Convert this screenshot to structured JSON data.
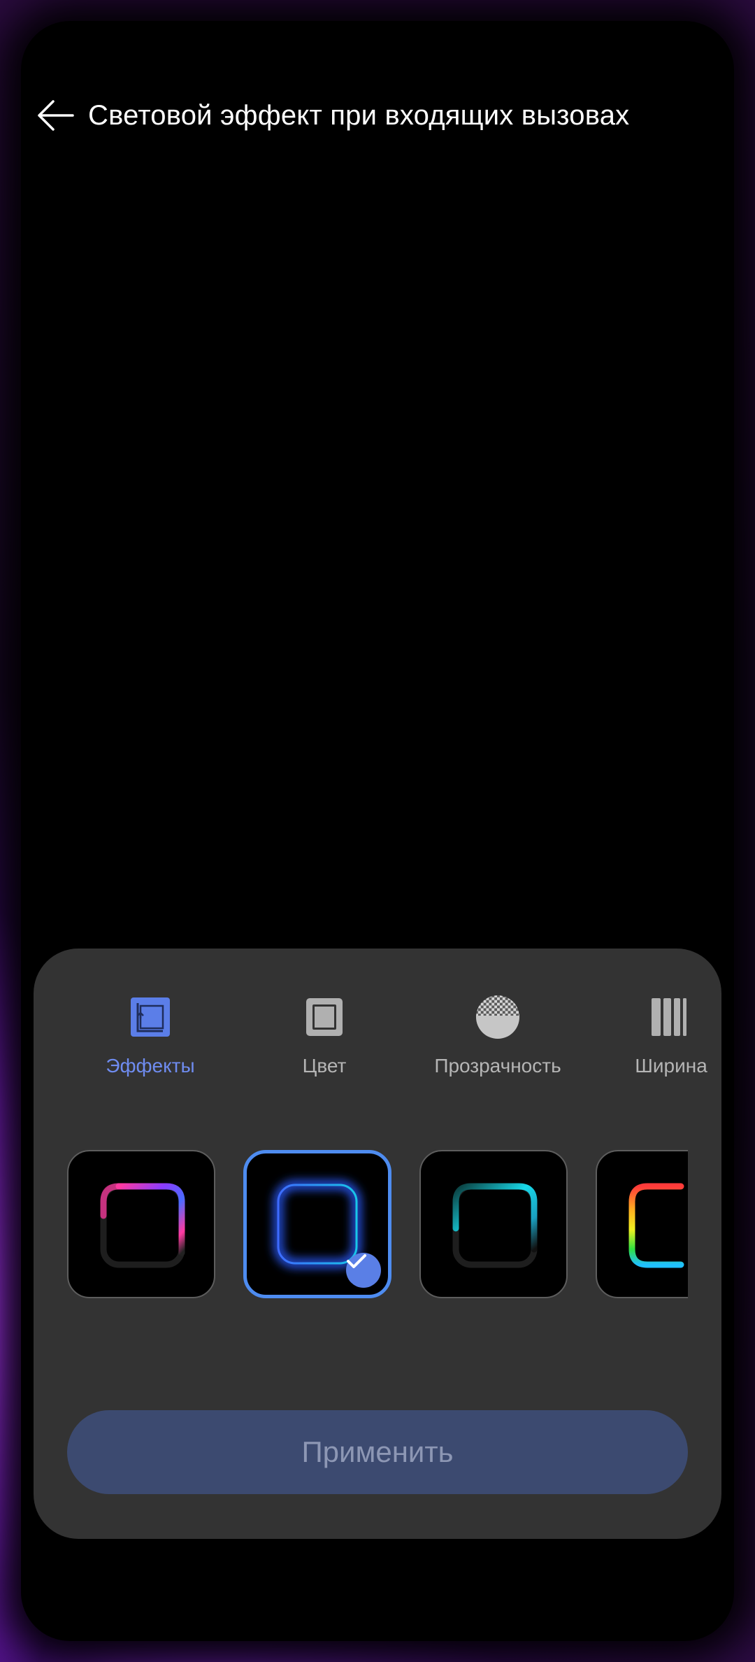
{
  "header": {
    "title": "Световой эффект при входящих вызовах",
    "back_icon": "arrow-left-icon"
  },
  "tabs": [
    {
      "label": "Эффекты",
      "icon": "effects-icon",
      "active": true
    },
    {
      "label": "Цвет",
      "icon": "color-frame-icon",
      "active": false
    },
    {
      "label": "Прозрачность",
      "icon": "transparency-icon",
      "active": false
    },
    {
      "label": "Ширина",
      "icon": "width-bars-icon",
      "active": false
    }
  ],
  "effects": [
    {
      "name": "purple-pink-gradient",
      "selected": false
    },
    {
      "name": "blue-glow",
      "selected": true
    },
    {
      "name": "cyan-gradient",
      "selected": false
    },
    {
      "name": "rainbow",
      "selected": false
    }
  ],
  "apply_button": {
    "label": "Применить"
  },
  "colors": {
    "accent": "#6f8cf0",
    "selected_border": "#4e8cf0",
    "panel": "#333333",
    "apply_bg": "#3c4a70",
    "edge_glow": "#b43cff"
  }
}
